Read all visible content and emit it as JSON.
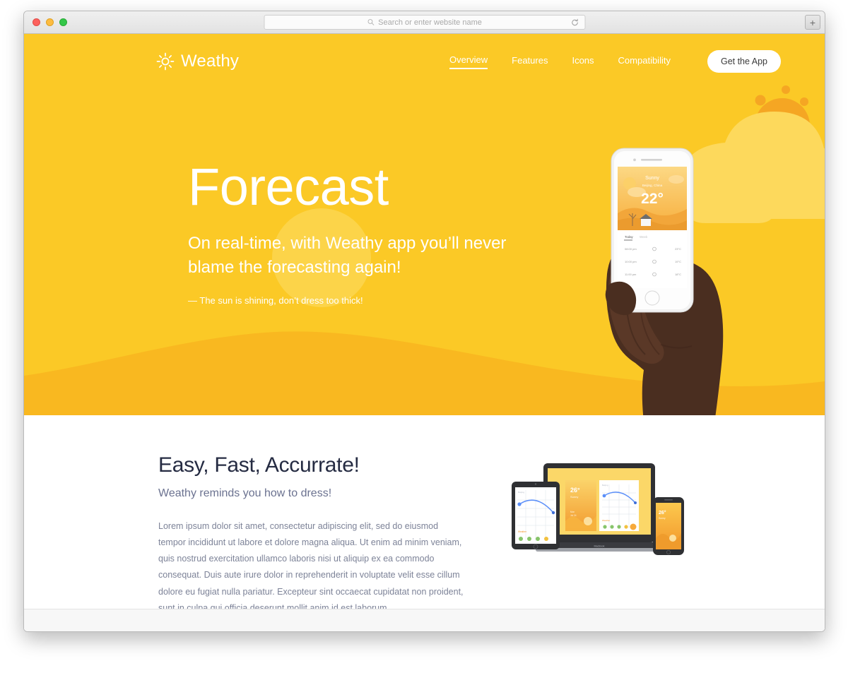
{
  "browser": {
    "traffic_lights": [
      "close",
      "minimize",
      "maximize"
    ],
    "url_placeholder": "Search or enter website name",
    "search_icon": "search-icon",
    "reload_icon": "reload-icon",
    "new_tab_label": "+"
  },
  "site": {
    "logo_icon": "sun-icon",
    "logo_text": "Weathy",
    "nav": [
      {
        "label": "Overview",
        "active": true
      },
      {
        "label": "Features",
        "active": false
      },
      {
        "label": "Icons",
        "active": false
      },
      {
        "label": "Compatibility",
        "active": false
      }
    ],
    "cta": "Get the App"
  },
  "hero": {
    "title": "Forecast",
    "subtitle": "On real-time, with Weathy app you’ll never blame the forecasting again!",
    "note": "— The sun is shining, don’t dress too thick!",
    "phone_screen": {
      "condition": "Sunny",
      "location": "Beijing, China",
      "temperature": "22°",
      "tab_active": "Today",
      "tab_inactive": "Week",
      "rows": [
        {
          "time": "08:00 pm",
          "icon": "sun-icon",
          "temp": "23°C"
        },
        {
          "time": "10:00 pm",
          "icon": "sun-icon",
          "temp": "19°C"
        },
        {
          "time": "11:00 pm",
          "icon": "sun-icon",
          "temp": "18°C"
        }
      ]
    }
  },
  "features": {
    "title": "Easy, Fast, Accurrate!",
    "subtitle": "Weathy reminds you how to dress!",
    "body": "Lorem ipsum dolor sit amet, consectetur adipiscing elit, sed do eiusmod tempor incididunt ut labore et dolore magna aliqua. Ut enim ad minim veniam, quis nostrud exercitation ullamco laboris nisi ut aliquip ex ea commodo consequat. Duis aute irure dolor in reprehenderit in voluptate velit esse cillum dolore eu fugiat nulla pariatur. Excepteur sint occaecat cupidatat non proident, sunt in culpa qui officia deserunt mollit anim id est laborum.",
    "devices": {
      "laptop_label": "MacBook",
      "screen_temp": "26°",
      "screen_condition": "Sunny"
    }
  },
  "colors": {
    "primary_yellow": "#fbc926",
    "wave_yellow": "#f9b820",
    "cloud_yellow": "#fdd95c",
    "sun_orange": "#f5a623",
    "heading_dark": "#252b42",
    "body_text": "#7d8398"
  }
}
